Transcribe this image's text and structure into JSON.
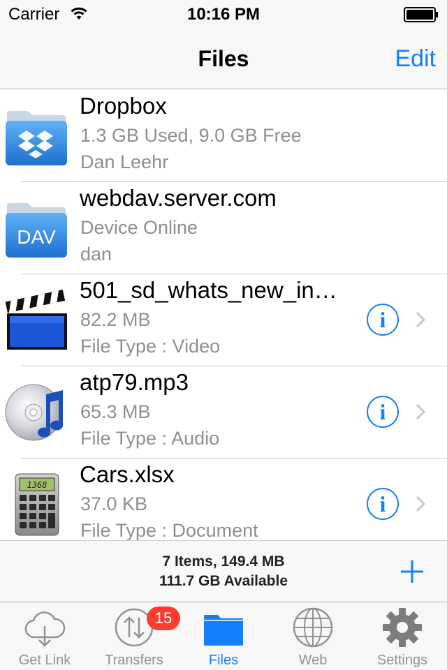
{
  "status_bar": {
    "carrier": "Carrier",
    "time": "10:16 PM"
  },
  "nav": {
    "title": "Files",
    "edit_label": "Edit"
  },
  "files": [
    {
      "name": "Dropbox",
      "line2": "1.3 GB Used, 9.0 GB Free",
      "line3": "Dan Leehr",
      "icon": "dropbox-folder-icon"
    },
    {
      "name": "webdav.server.com",
      "line2": "Device Online",
      "line3": "dan",
      "icon": "dav-folder-icon",
      "icon_text": "DAV"
    },
    {
      "name": "501_sd_whats_new_in…",
      "line2": "82.2 MB",
      "line3": "File Type : Video",
      "icon": "video-clapper-icon"
    },
    {
      "name": "atp79.mp3",
      "line2": "65.3 MB",
      "line3": "File Type : Audio",
      "icon": "audio-cd-icon"
    },
    {
      "name": "Cars.xlsx",
      "line2": "37.0 KB",
      "line3": "File Type : Document",
      "icon": "calculator-icon",
      "icon_text": "1368"
    }
  ],
  "summary": {
    "items": "7 Items, 149.4 MB",
    "available": "111.7 GB Available"
  },
  "tabs": [
    {
      "label": "Get Link",
      "icon": "cloud-download-icon"
    },
    {
      "label": "Transfers",
      "icon": "transfers-icon",
      "badge": "15"
    },
    {
      "label": "Files",
      "icon": "folder-icon",
      "active": true
    },
    {
      "label": "Web",
      "icon": "globe-icon"
    },
    {
      "label": "Settings",
      "icon": "gear-icon"
    }
  ],
  "colors": {
    "accent": "#157efb",
    "badge": "#ff3b30",
    "secondary_text": "#8e8e93"
  }
}
